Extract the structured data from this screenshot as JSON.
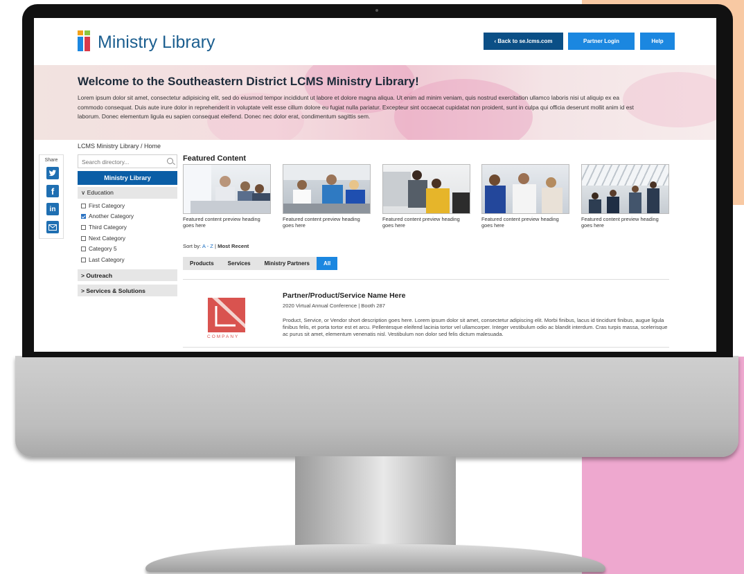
{
  "colors": {
    "primary": "#0b5ea6",
    "accent": "#1b87e0",
    "company_red": "#d9534f"
  },
  "header": {
    "logo_text": "Ministry Library",
    "back_button": "‹  Back to se.lcms.com",
    "partner_login": "Partner Login",
    "help": "Help"
  },
  "hero": {
    "title": "Welcome to the Southeastern District LCMS Ministry Library!",
    "text": "Lorem ipsum dolor sit amet, consectetur adipisicing elit, sed do eiusmod tempor incididunt ut labore et dolore magna aliqua. Ut enim ad minim veniam, quis nostrud exercitation ullamco laboris nisi ut aliquip ex ea commodo consequat. Duis aute irure dolor in reprehenderit in voluptate velit esse cillum dolore eu fugiat nulla pariatur. Excepteur sint occaecat cupidatat non proident, sunt in culpa qui officia deserunt mollit anim id est laborum. Donec elementum ligula eu sapien consequat eleifend. Donec nec dolor erat, condimentum sagittis sem."
  },
  "breadcrumb": "LCMS Ministry Library  / Home",
  "share": {
    "label": "Share",
    "icons": [
      "twitter-icon",
      "facebook-icon",
      "linkedin-icon",
      "email-icon"
    ]
  },
  "sidebar": {
    "search_placeholder": "Search directory...",
    "library_heading": "Ministry Library",
    "education": {
      "label": "∨ Education",
      "categories": [
        {
          "label": "First Category",
          "checked": false
        },
        {
          "label": "Another Category",
          "checked": true
        },
        {
          "label": "Third Category",
          "checked": false
        },
        {
          "label": "Next Category",
          "checked": false
        },
        {
          "label": "Category 5",
          "checked": false
        },
        {
          "label": "Last Category",
          "checked": false
        }
      ]
    },
    "outreach": "> Outreach",
    "services": "> Services & Solutions"
  },
  "featured": {
    "title": "Featured Content",
    "items": [
      {
        "caption": "Featured content preview heading goes here"
      },
      {
        "caption": "Featured content preview heading goes here"
      },
      {
        "caption": "Featured content preview heading goes here"
      },
      {
        "caption": "Featured content preview heading goes here"
      },
      {
        "caption": "Featured content preview heading goes here"
      }
    ]
  },
  "sort": {
    "label": "Sort by:",
    "az": "A - Z",
    "sep": "|",
    "recent": "Most Recent"
  },
  "tabs": [
    {
      "label": "Products",
      "active": false
    },
    {
      "label": "Services",
      "active": false
    },
    {
      "label": "Ministry Partners",
      "active": false
    },
    {
      "label": "All",
      "active": true
    }
  ],
  "listing": {
    "company_word": "COMPANY",
    "title": "Partner/Product/Service Name Here",
    "subtitle": "2020 Virtual Annual Conference  |  Booth 287",
    "description": "Product, Service, or Vendor short description goes here. Lorem ipsum dolor sit amet, consectetur adipiscing elit. Morbi finibus, lacus id tincidunt finibus, augue ligula finibus felis, et porta tortor est et arcu. Pellentesque eleifend lacinia tortor vel ullamcorper. Integer vestibulum odio ac blandit interdum. Cras turpis massa, scelerisque ac purus sit amet, elementum venenatis nisl. Vestibulum non dolor sed felis dictum malesuada."
  }
}
